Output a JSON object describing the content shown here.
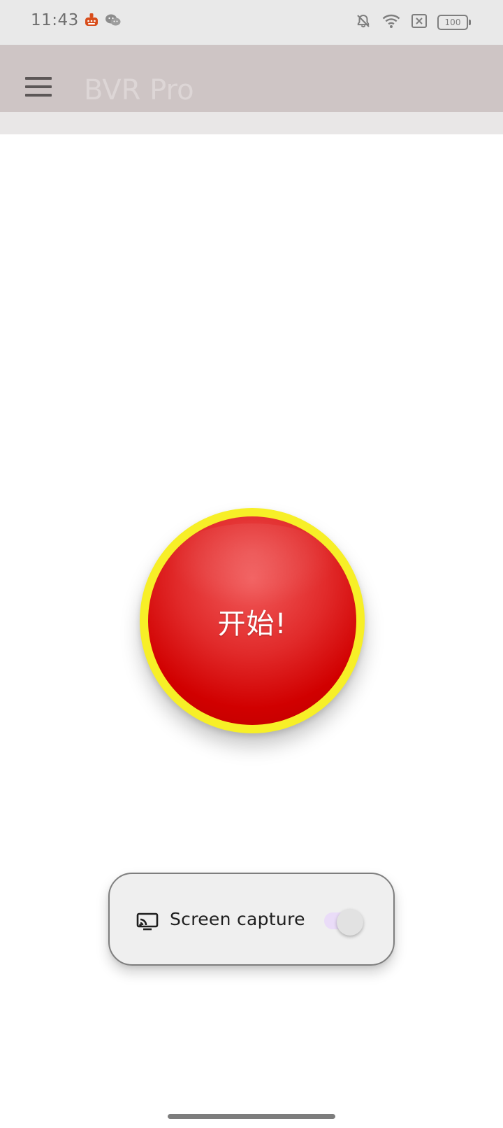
{
  "status_bar": {
    "time": "11:43",
    "left_icons": [
      "app-notification-icon",
      "wechat-icon"
    ],
    "right_icons": [
      "silent-bell-icon",
      "wifi-icon",
      "sim-off-icon"
    ],
    "battery": "100"
  },
  "app_bar": {
    "title": "BVR Pro",
    "menu_icon": "menu-icon"
  },
  "main": {
    "start_label": "开始!"
  },
  "capture_card": {
    "label": "Screen capture",
    "icon": "cast-icon",
    "toggle_state": "off"
  },
  "colors": {
    "app_bar": "#cec5c5",
    "start_ring": "#f7ef27",
    "start_button": "#d10000",
    "toggle_track": "#eadcf8"
  }
}
